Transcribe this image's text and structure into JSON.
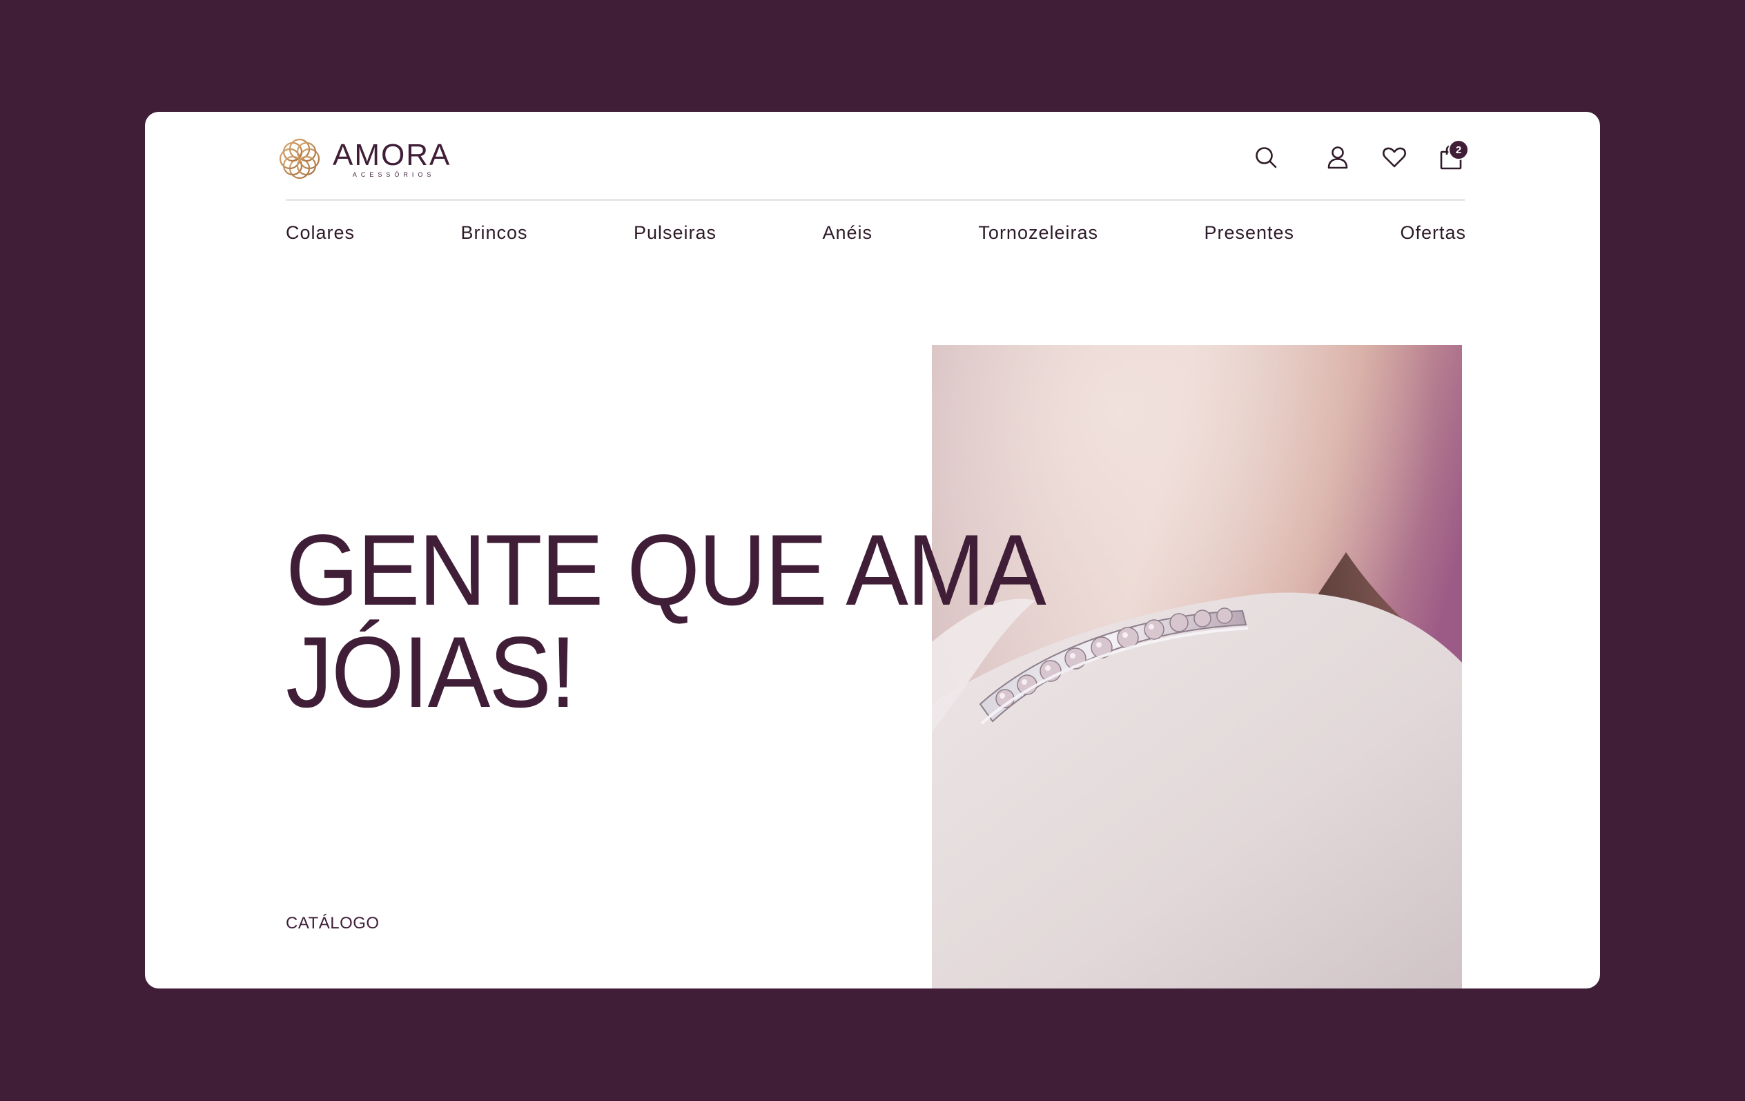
{
  "brand": {
    "name": "AMORA",
    "tagline": "ACESSÓRIOS",
    "colors": {
      "primary": "#401e38",
      "gold": "#c4925e",
      "background": "#ffffff"
    }
  },
  "header": {
    "icons": [
      "search-icon",
      "user-icon",
      "heart-icon",
      "shopping-bag-icon"
    ],
    "cart_count": "2"
  },
  "nav": {
    "items": [
      {
        "label": "Colares"
      },
      {
        "label": "Brincos"
      },
      {
        "label": "Pulseiras"
      },
      {
        "label": "Anéis"
      },
      {
        "label": "Tornozeleiras"
      },
      {
        "label": "Presentes"
      },
      {
        "label": "Ofertas"
      }
    ]
  },
  "hero": {
    "title_line1": "GENTE QUE AMA",
    "title_line2": "JÓIAS!",
    "cta": "CATÁLOGO",
    "image": "diamond-ring-photo"
  }
}
